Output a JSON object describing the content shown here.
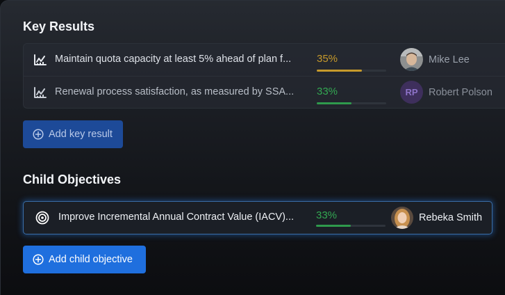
{
  "key_results": {
    "title": "Key Results",
    "items": [
      {
        "text": "Maintain quota capacity at least 5% ahead of plan f...",
        "progress_label": "35%",
        "progress": 0.65,
        "color": "#c79a2b",
        "owner": {
          "name": "Mike Lee",
          "avatar_type": "photo"
        }
      },
      {
        "text": "Renewal process satisfaction, as measured by SSA...",
        "progress_label": "33%",
        "progress": 0.5,
        "color": "#33a852",
        "owner": {
          "name": "Robert Polson",
          "avatar_type": "initials",
          "initials": "RP"
        }
      }
    ],
    "add_button": "Add key result"
  },
  "child_objectives": {
    "title": "Child Objectives",
    "items": [
      {
        "text": "Improve Incremental Annual Contract Value (IACV)...",
        "progress_label": "33%",
        "progress": 0.5,
        "color": "#33a852",
        "owner": {
          "name": "Rebeka Smith",
          "avatar_type": "photo"
        }
      }
    ],
    "add_button": "Add child objective"
  },
  "icons": {
    "key_result": "chart-trend-icon",
    "child_objective": "target-icon",
    "add": "plus-circle-icon"
  }
}
